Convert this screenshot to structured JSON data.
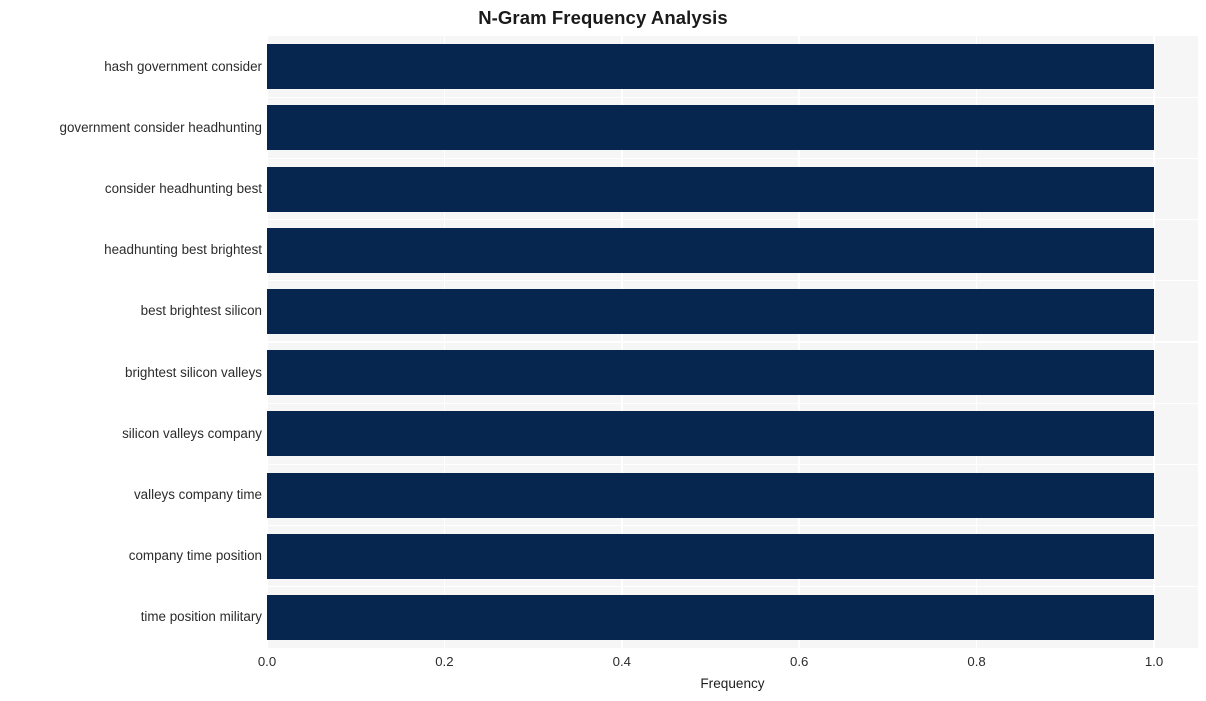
{
  "chart_data": {
    "type": "bar",
    "orientation": "horizontal",
    "title": "N-Gram Frequency Analysis",
    "xlabel": "Frequency",
    "ylabel": "",
    "xlim": [
      0.0,
      1.0
    ],
    "xticks": [
      "0.0",
      "0.2",
      "0.4",
      "0.6",
      "0.8",
      "1.0"
    ],
    "xtick_values": [
      0.0,
      0.2,
      0.4,
      0.6,
      0.8,
      1.0
    ],
    "grid": true,
    "legend": null,
    "bar_color": "#06254f",
    "plot_background": "#f6f6f7",
    "categories": [
      "hash government consider",
      "government consider headhunting",
      "consider headhunting best",
      "headhunting best brightest",
      "best brightest silicon",
      "brightest silicon valleys",
      "silicon valleys company",
      "valleys company time",
      "company time position",
      "time position military"
    ],
    "values": [
      1.0,
      1.0,
      1.0,
      1.0,
      1.0,
      1.0,
      1.0,
      1.0,
      1.0,
      1.0
    ]
  }
}
